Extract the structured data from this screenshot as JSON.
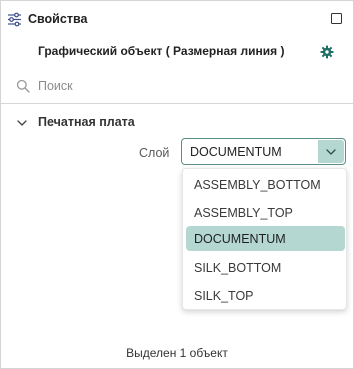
{
  "header": {
    "title": "Свойства",
    "icon": "sliders-icon",
    "maximize_icon": "maximize-icon"
  },
  "object": {
    "title": "Графический объект ( Размерная линия )",
    "settings_icon": "gear-icon"
  },
  "search": {
    "placeholder": "Поиск",
    "value": "",
    "icon": "search-icon"
  },
  "section": {
    "title": "Печатная плата",
    "expanded": true,
    "chevron_icon": "chevron-down-icon"
  },
  "property": {
    "label": "Слой",
    "value": "DOCUMENTUM",
    "open": true
  },
  "dropdown": {
    "options": [
      {
        "label": "ASSEMBLY_BOTTOM",
        "selected": false
      },
      {
        "label": "ASSEMBLY_TOP",
        "selected": false
      },
      {
        "label": "DOCUMENTUM",
        "selected": true
      },
      {
        "label": "SILK_BOTTOM",
        "selected": false
      },
      {
        "label": "SILK_TOP",
        "selected": false
      }
    ]
  },
  "status": {
    "text": "Выделен 1 объект"
  },
  "colors": {
    "accent": "#b4d8d1",
    "accent_border": "#5a8f86",
    "gear": "#1f6f64"
  }
}
